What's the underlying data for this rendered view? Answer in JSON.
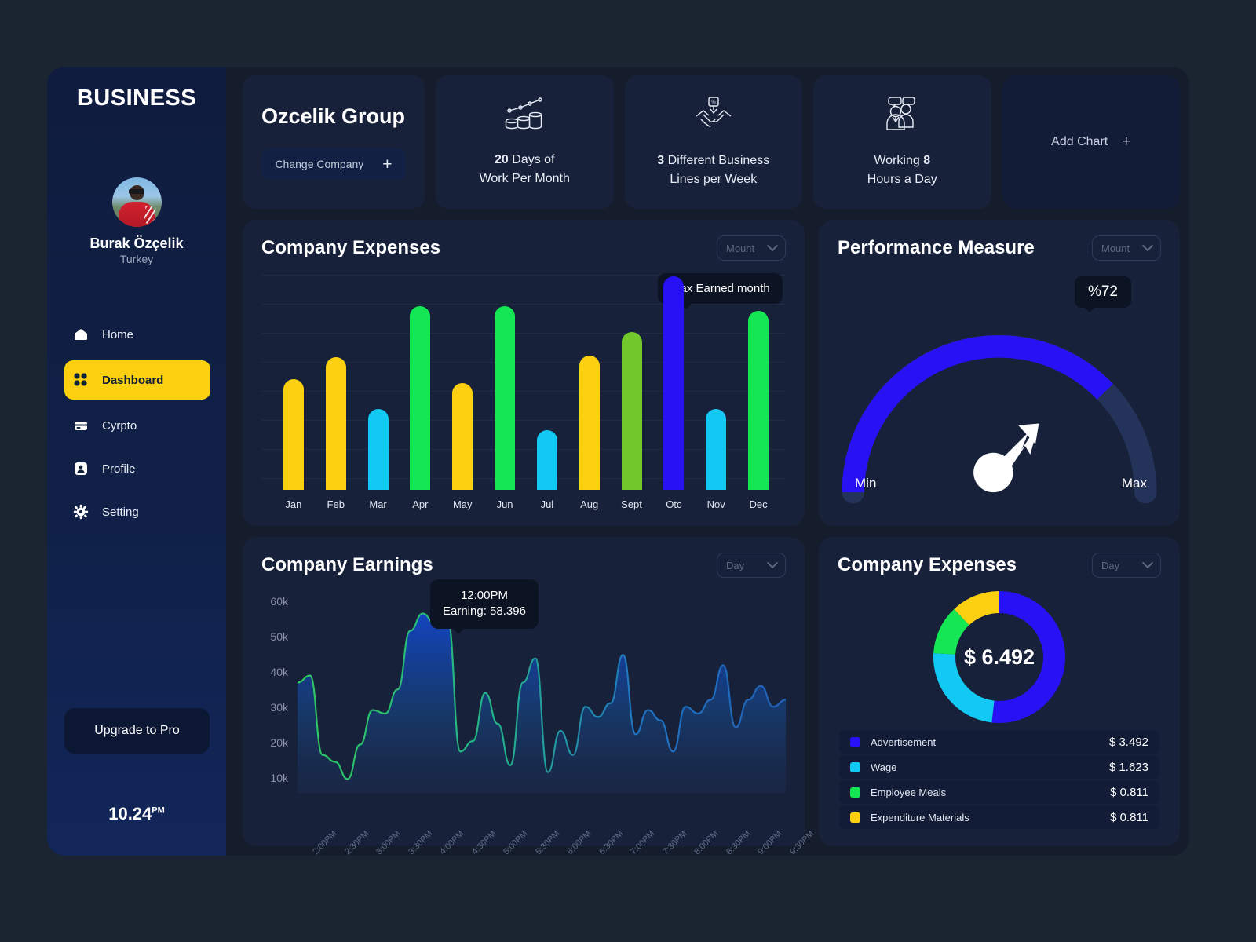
{
  "sidebar": {
    "brand": "BUSINESS",
    "user_name": "Burak Özçelik",
    "user_location": "Turkey",
    "items": [
      {
        "label": "Home",
        "icon": "home-icon",
        "active": false
      },
      {
        "label": "Dashboard",
        "icon": "grid-icon",
        "active": true
      },
      {
        "label": "Cyrpto",
        "icon": "card-icon",
        "active": false
      },
      {
        "label": "Profile",
        "icon": "person-icon",
        "active": false
      },
      {
        "label": "Setting",
        "icon": "gear-icon",
        "active": false
      }
    ],
    "upgrade_label": "Upgrade to Pro",
    "clock_time": "10.24",
    "clock_period": "PM"
  },
  "topbar": {
    "company_name": "Ozcelik Group",
    "change_company_label": "Change Company",
    "change_company_plus": "+",
    "stats": [
      {
        "icon": "coins-growth-icon",
        "value": "20",
        "line1_rest": " Days of",
        "line2": "Work Per Month"
      },
      {
        "icon": "handshake-icon",
        "value": "3",
        "line1_rest": " Different Business",
        "line2": "Lines per Week"
      },
      {
        "icon": "team-chat-icon",
        "value": "8",
        "line1_pre": "Working ",
        "line2": "Hours a Day"
      }
    ],
    "add_chart_label": "Add Chart",
    "add_chart_plus": "+"
  },
  "expenses_bar": {
    "title": "Company Expenses",
    "dropdown": "Mount",
    "tooltip": "Max Earned month"
  },
  "performance": {
    "title": "Performance Measure",
    "dropdown": "Mount",
    "value_label": "%72",
    "min_label": "Min",
    "max_label": "Max"
  },
  "earnings": {
    "title": "Company Earnings",
    "dropdown": "Day",
    "tooltip_time": "12:00PM",
    "tooltip_value": "Earning: 58.396"
  },
  "expenses_donut": {
    "title": "Company Expenses",
    "dropdown": "Day",
    "center_value": "$ 6.492"
  },
  "colors": {
    "yellow": "#fbd010",
    "green": "#15e654",
    "cyan": "#12c9f4",
    "blue": "#2612f4",
    "light_green": "#72c72c",
    "panel": "#18213a",
    "accent": "#fbd010"
  },
  "chart_data": [
    {
      "type": "bar",
      "title": "Company Expenses",
      "categories": [
        "Jan",
        "Feb",
        "Mar",
        "Apr",
        "May",
        "Jun",
        "Jul",
        "Aug",
        "Sept",
        "Otc",
        "Nov",
        "Dec"
      ],
      "values": [
        52,
        62,
        38,
        86,
        50,
        86,
        28,
        63,
        74,
        100,
        38,
        84
      ],
      "colors": [
        "#fbd010",
        "#fbd010",
        "#12c9f4",
        "#15e654",
        "#fbd010",
        "#15e654",
        "#12c9f4",
        "#fbd010",
        "#72c72c",
        "#2612f4",
        "#12c9f4",
        "#15e654"
      ],
      "xlabel": "",
      "ylabel": "",
      "ylim": [
        0,
        100
      ],
      "grid": true,
      "annotations": [
        {
          "at": "Otc",
          "text": "Max Earned month"
        }
      ]
    },
    {
      "type": "gauge",
      "title": "Performance Measure",
      "value": 72,
      "min_label": "Min",
      "max_label": "Max",
      "display": "%72",
      "arc_color": "#2612f4",
      "track_color": "#243254"
    },
    {
      "type": "area",
      "title": "Company Earnings",
      "ylabel": "",
      "xlabel": "",
      "yticks": [
        "10k",
        "20k",
        "30k",
        "40k",
        "50k",
        "60k"
      ],
      "ylim": [
        10000,
        65000
      ],
      "xticks": [
        "2:00PM",
        "2:30PM",
        "3:00PM",
        "3:30PM",
        "4:00PM",
        "4:30PM",
        "5:00PM",
        "5:30PM",
        "6:00PM",
        "6:30PM",
        "7:00PM",
        "7:30PM",
        "8:00PM",
        "8:30PM",
        "9:00PM",
        "9:30PM"
      ],
      "highlight_point": {
        "x": "12:00PM",
        "y": 58396,
        "label": "Earning: 58.396"
      },
      "values": [
        40,
        42,
        19,
        17,
        12,
        22,
        32,
        31,
        38,
        55,
        60,
        57,
        58,
        20,
        23,
        37,
        28,
        16,
        40,
        47,
        14,
        26,
        19,
        33,
        30,
        34,
        48,
        25,
        32,
        29,
        20,
        33,
        31,
        35,
        45,
        27,
        35,
        39,
        33,
        35
      ]
    },
    {
      "type": "pie",
      "title": "Company Expenses",
      "center": "$ 6.492",
      "labels": [
        "Advertisement",
        "Wage",
        "Employee Meals",
        "Expenditure Materials"
      ],
      "values": [
        3.492,
        1.623,
        0.811,
        0.811
      ],
      "value_labels": [
        "$ 3.492",
        "$ 1.623",
        "$ 0.811",
        "$ 0.811"
      ],
      "colors": [
        "#2612f4",
        "#12c9f4",
        "#15e654",
        "#fbd010"
      ]
    }
  ]
}
